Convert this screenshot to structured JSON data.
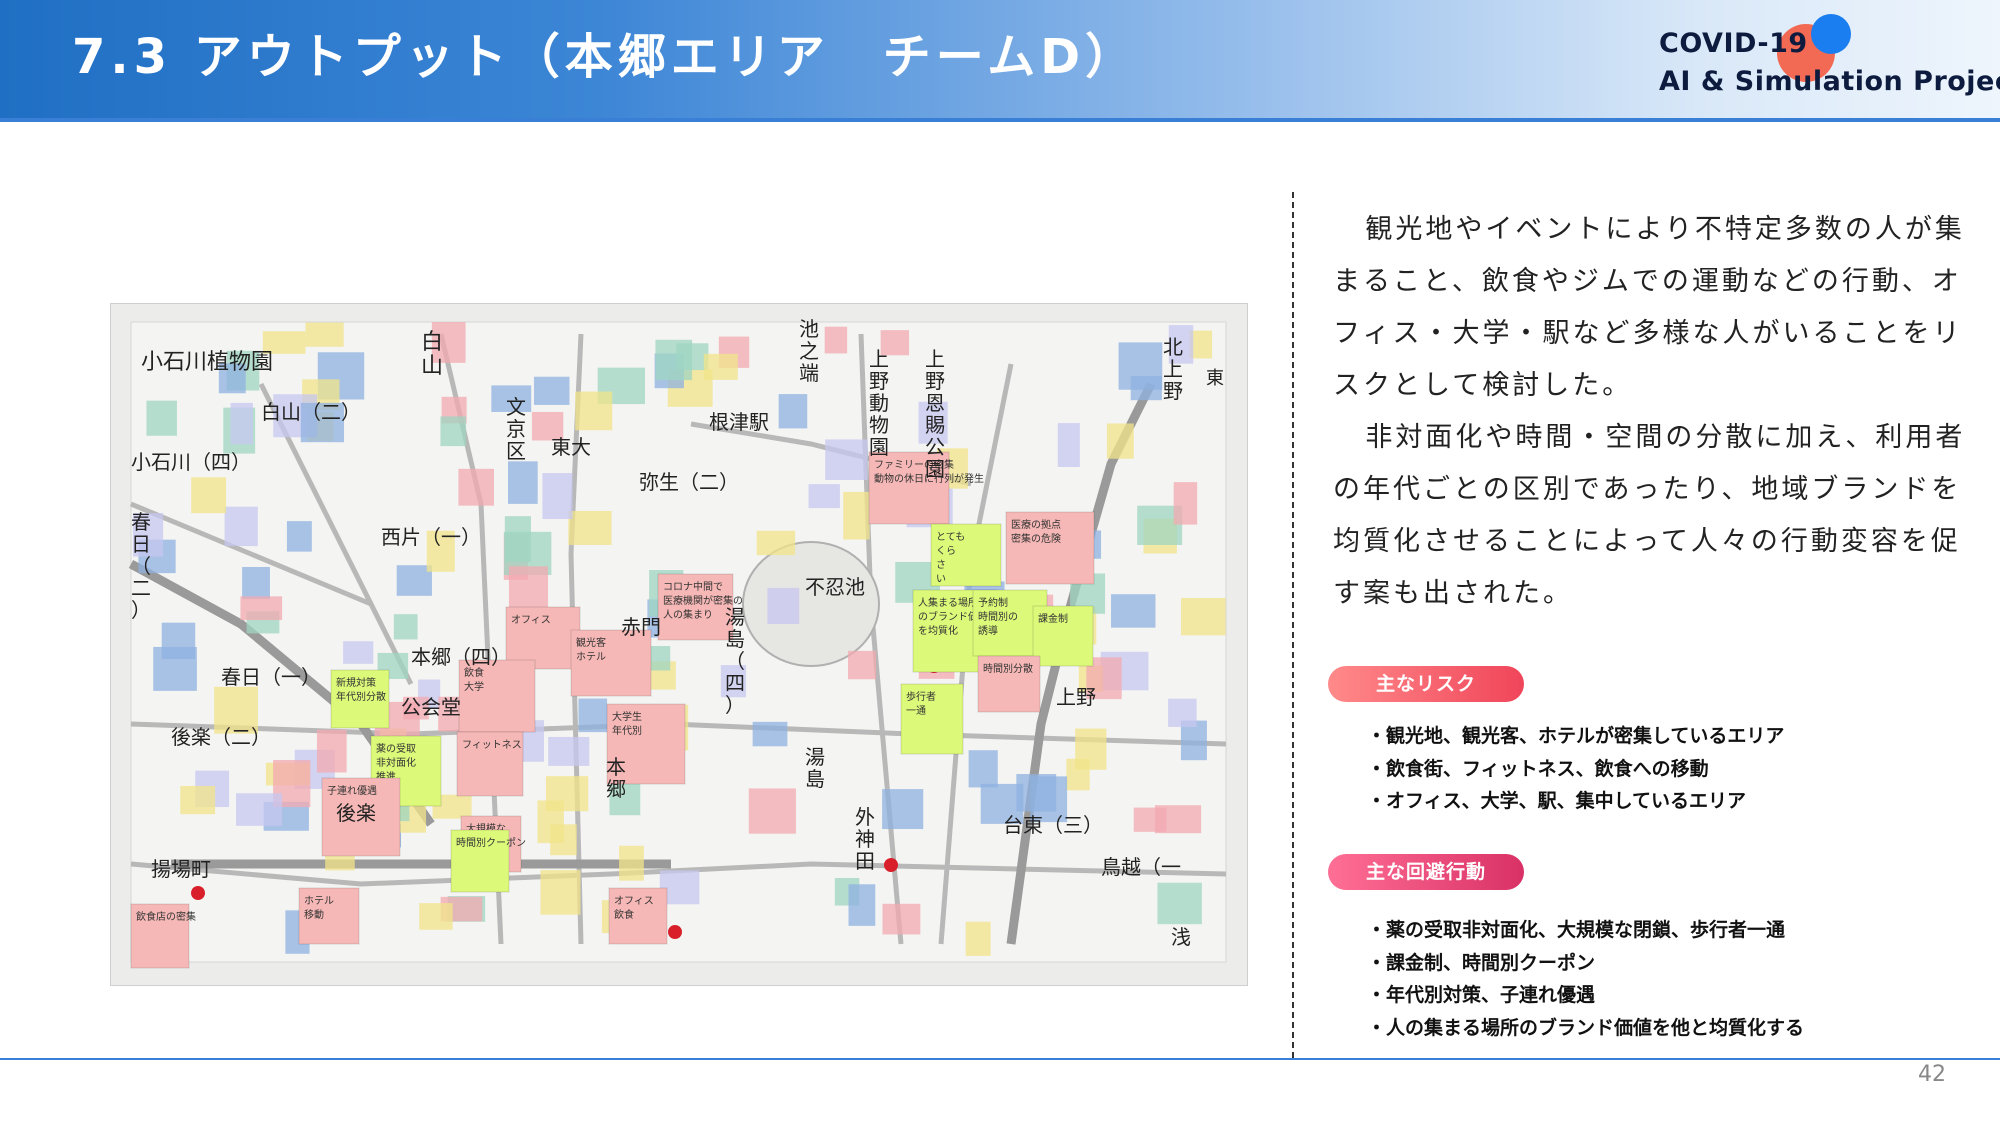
{
  "header": {
    "title": "7.3 アウトプット（本郷エリア　チームD）",
    "logo_line1": "COVID-19",
    "logo_line2": "AI & Simulation Project",
    "logo_colors": {
      "circle_orange": "#f26a53",
      "circle_blue": "#1a7ef0"
    },
    "accent_color": "#1f6fc4"
  },
  "map": {
    "area_labels": [
      "小石川植物園",
      "白山（二）",
      "小石川（四）",
      "春日（二）",
      "春日（一）",
      "後楽（二）",
      "揚場町",
      "後楽",
      "白山",
      "文京区",
      "西片（一）",
      "本郷（四）",
      "公会堂",
      "東大",
      "赤門",
      "本郷",
      "弥生（二）",
      "根津駅",
      "池之端",
      "不忍池",
      "湯島（四）",
      "湯島",
      "外神田",
      "上野動物園",
      "上野恩賜公園",
      "上野",
      "台東（三）",
      "鳥越（一",
      "北上野",
      "浅",
      "東"
    ],
    "sticky_notes": [
      {
        "text": "ファミリーの密集 動物の休日に行列が発生",
        "color": "pink"
      },
      {
        "text": "とても くら さ い",
        "color": "green"
      },
      {
        "text": "医療の拠点 密集の危険",
        "color": "pink"
      },
      {
        "text": "コロナ中間で 医療機関が密集の 人の集まり",
        "color": "pink"
      },
      {
        "text": "人集まる場所 のブランド価値 を均質化",
        "color": "green"
      },
      {
        "text": "予約制 時間別の 誘導",
        "color": "green"
      },
      {
        "text": "課金制",
        "color": "green"
      },
      {
        "text": "時間別分散",
        "color": "pink"
      },
      {
        "text": "歩行者 一通",
        "color": "green"
      },
      {
        "text": "オフィス",
        "color": "pink"
      },
      {
        "text": "観光客 ホテル",
        "color": "pink"
      },
      {
        "text": "飲食 大学",
        "color": "pink"
      },
      {
        "text": "新規対策 年代別分散",
        "color": "green"
      },
      {
        "text": "薬の受取 非対面化 推進",
        "color": "green"
      },
      {
        "text": "フィットネス",
        "color": "pink"
      },
      {
        "text": "大規模な 閉鎖",
        "color": "pink"
      },
      {
        "text": "子連れ優遇",
        "color": "pink"
      },
      {
        "text": "時間別クーポン",
        "color": "green"
      },
      {
        "text": "大学生 年代別",
        "color": "pink"
      },
      {
        "text": "オフィス 飲食",
        "color": "pink"
      },
      {
        "text": "ホテル 移動",
        "color": "pink"
      },
      {
        "text": "飲食店の密集",
        "color": "pink"
      }
    ]
  },
  "right": {
    "paragraph1": "観光地やイベントにより不特定多数の人が集まること、飲食やジムでの運動などの行動、オフィス・大学・駅など多様な人がいることをリスクとして検討した。",
    "paragraph2": "非対面化や時間・空間の分散に加え、利用者の年代ごとの区別であったり、地域ブランドを均質化させることによって人々の行動変容を促す案も出された。",
    "risk_label": "主なリスク",
    "risks": [
      "・観光地、観光客、ホテルが密集しているエリア",
      "・飲食街、フィットネス、飲食への移動",
      "・オフィス、大学、駅、集中しているエリア"
    ],
    "avoid_label": "主な回避行動",
    "avoids": [
      "・薬の受取非対面化、大規模な閉鎖、歩行者一通",
      "・課金制、時間別クーポン",
      "・年代別対策、子連れ優遇",
      "・人の集まる場所のブランド価値を他と均質化する"
    ]
  },
  "footer": {
    "page_number": "42"
  }
}
